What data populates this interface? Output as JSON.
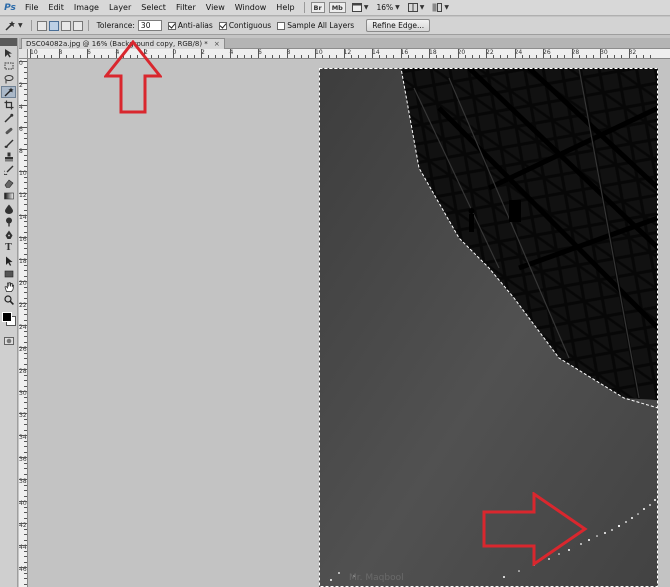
{
  "app": {
    "logo": "Ps"
  },
  "menu": {
    "items": [
      "File",
      "Edit",
      "Image",
      "Layer",
      "Select",
      "Filter",
      "View",
      "Window",
      "Help"
    ],
    "bridge_btn": "Br",
    "minibridge_btn": "Mb",
    "zoom": "16%"
  },
  "options": {
    "tolerance_label": "Tolerance:",
    "tolerance_value": "30",
    "anti_alias_label": "Anti-alias",
    "anti_alias_checked": true,
    "contiguous_label": "Contiguous",
    "contiguous_checked": true,
    "sample_all_label": "Sample All Layers",
    "sample_all_checked": false,
    "refine_edge_label": "Refine Edge..."
  },
  "document": {
    "tab_title": "DSC04082a.jpg @ 16% (Background copy, RGB/8) *",
    "close_glyph": "×"
  },
  "rulers": {
    "top": [
      "10",
      "8",
      "6",
      "4",
      "2",
      "0",
      "2",
      "4",
      "6",
      "8",
      "10",
      "12",
      "14",
      "16",
      "18",
      "20",
      "22",
      "24",
      "26",
      "28",
      "30",
      "32"
    ],
    "left": [
      "0",
      "2",
      "4",
      "6",
      "8",
      "10",
      "12",
      "14",
      "16",
      "18",
      "20",
      "22",
      "24",
      "26",
      "28",
      "30",
      "32",
      "34",
      "36",
      "38",
      "40",
      "42",
      "44",
      "46",
      "48"
    ]
  },
  "photo": {
    "watermark": "Mr. Maqbool"
  },
  "tools": [
    "move-tool-icon",
    "marquee-tool-icon",
    "lasso-tool-icon",
    "magic-wand-tool-icon",
    "crop-tool-icon",
    "eyedropper-tool-icon",
    "healing-brush-tool-icon",
    "brush-tool-icon",
    "clone-stamp-tool-icon",
    "history-brush-tool-icon",
    "eraser-tool-icon",
    "gradient-tool-icon",
    "blur-tool-icon",
    "dodge-tool-icon",
    "pen-tool-icon",
    "type-tool-icon",
    "path-selection-tool-icon",
    "shape-tool-icon",
    "hand-tool-icon",
    "zoom-tool-icon"
  ],
  "colors": {
    "annotation": "#d9272e",
    "foreground": "#000000",
    "background": "#ffffff"
  }
}
